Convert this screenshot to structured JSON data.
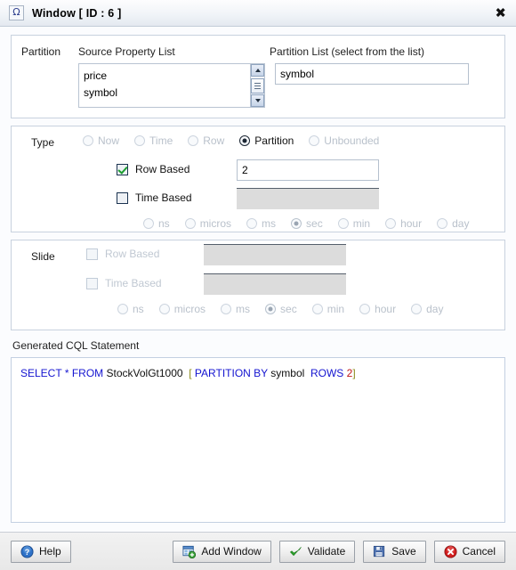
{
  "titlebar": {
    "icon": "omega-icon",
    "icon_glyph": "Ω",
    "title": "Window [ ID : 6 ]",
    "close_glyph": "✖"
  },
  "partition": {
    "section_label": "Partition",
    "source_list_header": "Source Property List",
    "source_items": [
      "price",
      "symbol"
    ],
    "partition_list_header": "Partition List (select from the list)",
    "partition_value": "symbol"
  },
  "type": {
    "section_label": "Type",
    "options": [
      {
        "label": "Now",
        "selected": false,
        "enabled": false
      },
      {
        "label": "Time",
        "selected": false,
        "enabled": false
      },
      {
        "label": "Row",
        "selected": false,
        "enabled": false
      },
      {
        "label": "Partition",
        "selected": true,
        "enabled": true
      },
      {
        "label": "Unbounded",
        "selected": false,
        "enabled": false
      }
    ],
    "row_based_label": "Row Based",
    "row_based_checked": true,
    "row_based_value": "2",
    "time_based_label": "Time Based",
    "time_based_checked": false,
    "time_based_value": "",
    "units": [
      {
        "label": "ns",
        "selected": false
      },
      {
        "label": "micros",
        "selected": false
      },
      {
        "label": "ms",
        "selected": false
      },
      {
        "label": "sec",
        "selected": true
      },
      {
        "label": "min",
        "selected": false
      },
      {
        "label": "hour",
        "selected": false
      },
      {
        "label": "day",
        "selected": false
      }
    ]
  },
  "slide": {
    "section_label": "Slide",
    "row_based_label": "Row Based",
    "row_based_checked": false,
    "row_based_value": "",
    "time_based_label": "Time Based",
    "time_based_checked": false,
    "time_based_value": "",
    "units": [
      {
        "label": "ns",
        "selected": false
      },
      {
        "label": "micros",
        "selected": false
      },
      {
        "label": "ms",
        "selected": false
      },
      {
        "label": "sec",
        "selected": true
      },
      {
        "label": "min",
        "selected": false
      },
      {
        "label": "hour",
        "selected": false
      },
      {
        "label": "day",
        "selected": false
      }
    ]
  },
  "cql": {
    "label": "Generated CQL Statement",
    "tokens": [
      {
        "text": "SELECT",
        "cls": "kw"
      },
      {
        "text": " ",
        "cls": "id"
      },
      {
        "text": "*",
        "cls": "kw"
      },
      {
        "text": " ",
        "cls": "id"
      },
      {
        "text": "FROM",
        "cls": "kw"
      },
      {
        "text": " ",
        "cls": "id"
      },
      {
        "text": "StockVolGt1000",
        "cls": "id"
      },
      {
        "text": "  ",
        "cls": "id"
      },
      {
        "text": "[",
        "cls": "brk"
      },
      {
        "text": " ",
        "cls": "id"
      },
      {
        "text": "PARTITION BY",
        "cls": "kw"
      },
      {
        "text": " ",
        "cls": "id"
      },
      {
        "text": "symbol",
        "cls": "id"
      },
      {
        "text": "  ",
        "cls": "id"
      },
      {
        "text": "ROWS",
        "cls": "kw"
      },
      {
        "text": " ",
        "cls": "id"
      },
      {
        "text": "2",
        "cls": "num"
      },
      {
        "text": "]",
        "cls": "brk"
      }
    ],
    "plain": "SELECT * FROM StockVolGt1000  [ PARTITION BY symbol  ROWS 2]"
  },
  "footer": {
    "help_label": "Help",
    "add_window_label": "Add Window",
    "validate_label": "Validate",
    "save_label": "Save",
    "cancel_label": "Cancel"
  },
  "colors": {
    "accent_blue": "#1414d0",
    "number_red": "#c01515",
    "bracket_olive": "#8b8b1a",
    "check_green": "#1a9d2f",
    "cancel_red": "#d32020",
    "help_blue": "#2f72c8"
  }
}
